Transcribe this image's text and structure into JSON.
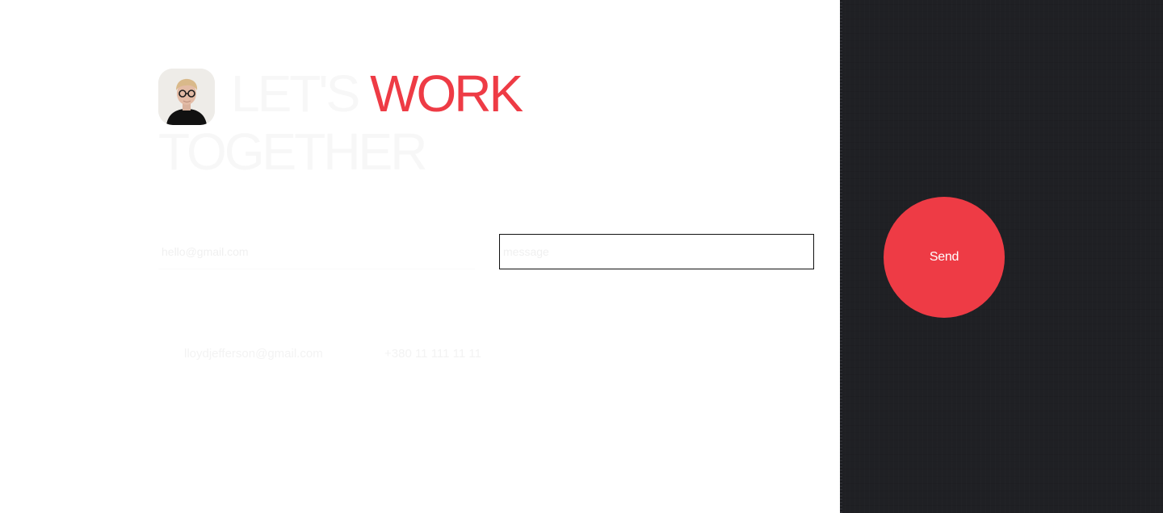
{
  "headline": {
    "part1": "LET'S",
    "accent": "WORK",
    "part2": "TOGETHER"
  },
  "form": {
    "email_placeholder": "hello@gmail.com",
    "message_placeholder": "message",
    "send_label": "Send"
  },
  "contact": {
    "email": "lloydjefferson@gmail.com",
    "phone": "+380 11 111 11 11"
  },
  "colors": {
    "accent": "#ee3b45",
    "dark_panel": "#1f2024",
    "background": "#ffffff"
  }
}
